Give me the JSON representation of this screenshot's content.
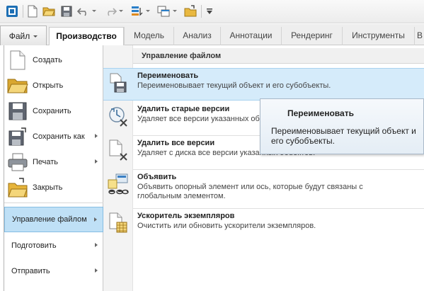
{
  "quick_access": {
    "icons": [
      "app-logo-icon",
      "new-file-icon",
      "open-folder-icon",
      "save-icon",
      "undo-icon",
      "redo-icon",
      "regenerate-icon",
      "windows-icon",
      "close-window-icon",
      "customize-icon"
    ]
  },
  "tabs": {
    "file": "Файл",
    "items": [
      "Производство",
      "Модель",
      "Анализ",
      "Аннотации",
      "Рендеринг",
      "Инструменты",
      "В"
    ]
  },
  "file_menu": {
    "items": [
      {
        "label": "Создать",
        "icon": "new-document-icon",
        "submenu": false
      },
      {
        "label": "Открыть",
        "icon": "open-folder-icon",
        "submenu": false
      },
      {
        "label": "Сохранить",
        "icon": "save-icon",
        "submenu": false
      },
      {
        "label": "Сохранить как",
        "icon": "save-as-icon",
        "submenu": true
      },
      {
        "label": "Печать",
        "icon": "printer-icon",
        "submenu": true
      },
      {
        "label": "Закрыть",
        "icon": "close-folder-icon",
        "submenu": false
      },
      {
        "label": "Управление файлом",
        "submenu": true,
        "selected": true
      },
      {
        "label": "Подготовить",
        "submenu": true
      },
      {
        "label": "Отправить",
        "submenu": true
      }
    ]
  },
  "submenu": {
    "header": "Управление файлом",
    "entries": [
      {
        "title": "Переименовать",
        "desc": "Переименовывает текущий объект и его субобъекты.",
        "icon": "rename-icon",
        "highlighted": true
      },
      {
        "title": "Удалить старые версии",
        "desc": "Удаляет все версии указанных об",
        "icon": "delete-old-versions-icon"
      },
      {
        "title": "Удалить все версии",
        "desc": "Удаляет с диска все версии указанных объектов.",
        "icon": "delete-all-versions-icon"
      },
      {
        "title": "Объявить",
        "desc": "Объявить опорный элемент или ось, которые будут связаны с глобальным элементом.",
        "icon": "declare-icon"
      },
      {
        "title": "Ускоритель экземпляров",
        "desc": "Очистить или обновить ускорители экземпляров.",
        "icon": "instance-accelerator-icon"
      }
    ]
  },
  "tooltip": {
    "title": "Переименовать",
    "body": "Переименовывает текущий объект и его субобъекты."
  },
  "colors": {
    "selected_bg": "#bfe0f6",
    "highlight_bg": "#d5ebfa",
    "tooltip_border": "#a9b9c9"
  }
}
